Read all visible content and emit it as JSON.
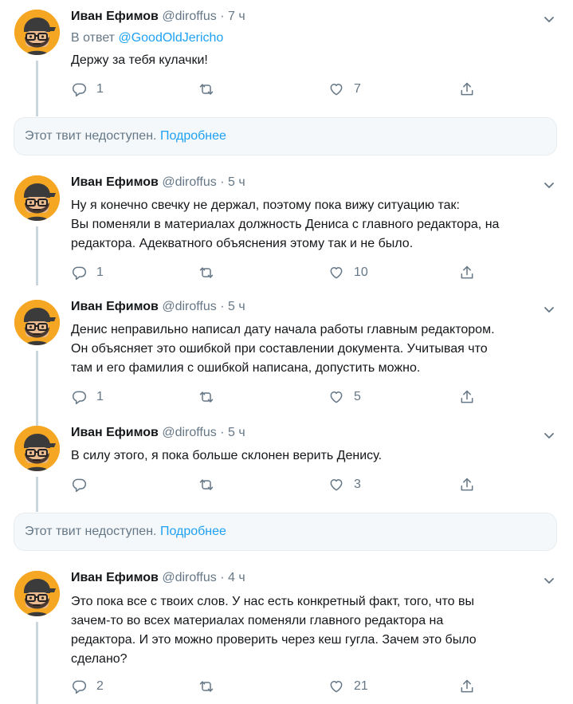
{
  "colors": {
    "accent": "#1da1f2",
    "muted": "#657786",
    "avatar_bg": "#f5a623",
    "line": "#ccd6dd"
  },
  "tweets": [
    {
      "name": "Иван Ефимов",
      "handle": "@diroffus",
      "dot": "·",
      "time": "7 ч",
      "reply_prefix": "В ответ",
      "reply_mention": "@GoodOldJericho",
      "lines": [
        "Держу за тебя кулачки!"
      ],
      "replies": "1",
      "retweets": "",
      "likes": "7"
    },
    {
      "name": "Иван Ефимов",
      "handle": "@diroffus",
      "dot": "·",
      "time": "5 ч",
      "lines": [
        "Ну я конечно свечку не держал, поэтому пока вижу ситуацию так:",
        "Вы поменяли в материалах должность Дениса с главного редактора, на",
        "редактора. Адекватного объяснения этому так и не было."
      ],
      "replies": "1",
      "retweets": "",
      "likes": "10"
    },
    {
      "name": "Иван Ефимов",
      "handle": "@diroffus",
      "dot": "·",
      "time": "5 ч",
      "lines": [
        "Денис неправильно написал дату начала работы главным редактором.",
        "Он объясняет это ошибкой при составлении документа. Учитывая что",
        "там и его фамилия с ошибкой написана, допустить можно."
      ],
      "replies": "1",
      "retweets": "",
      "likes": "5"
    },
    {
      "name": "Иван Ефимов",
      "handle": "@diroffus",
      "dot": "·",
      "time": "5 ч",
      "lines": [
        "В силу этого, я пока больше склонен верить Денису."
      ],
      "replies": "",
      "retweets": "",
      "likes": "3"
    },
    {
      "name": "Иван Ефимов",
      "handle": "@diroffus",
      "dot": "·",
      "time": "4 ч",
      "lines": [
        "Это пока все с твоих слов. У нас есть конкретный факт, того, что вы",
        "зачем-то во всех материалах поменяли главного редактора на",
        "редактора. И это можно проверить через кеш гугла. Зачем это было",
        "сделано?"
      ],
      "replies": "2",
      "retweets": "",
      "likes": "21"
    }
  ],
  "unavailable": [
    {
      "text": "Этот твит недоступен.",
      "link": "Подробнее"
    },
    {
      "text": "Этот твит недоступен.",
      "link": "Подробнее"
    }
  ]
}
